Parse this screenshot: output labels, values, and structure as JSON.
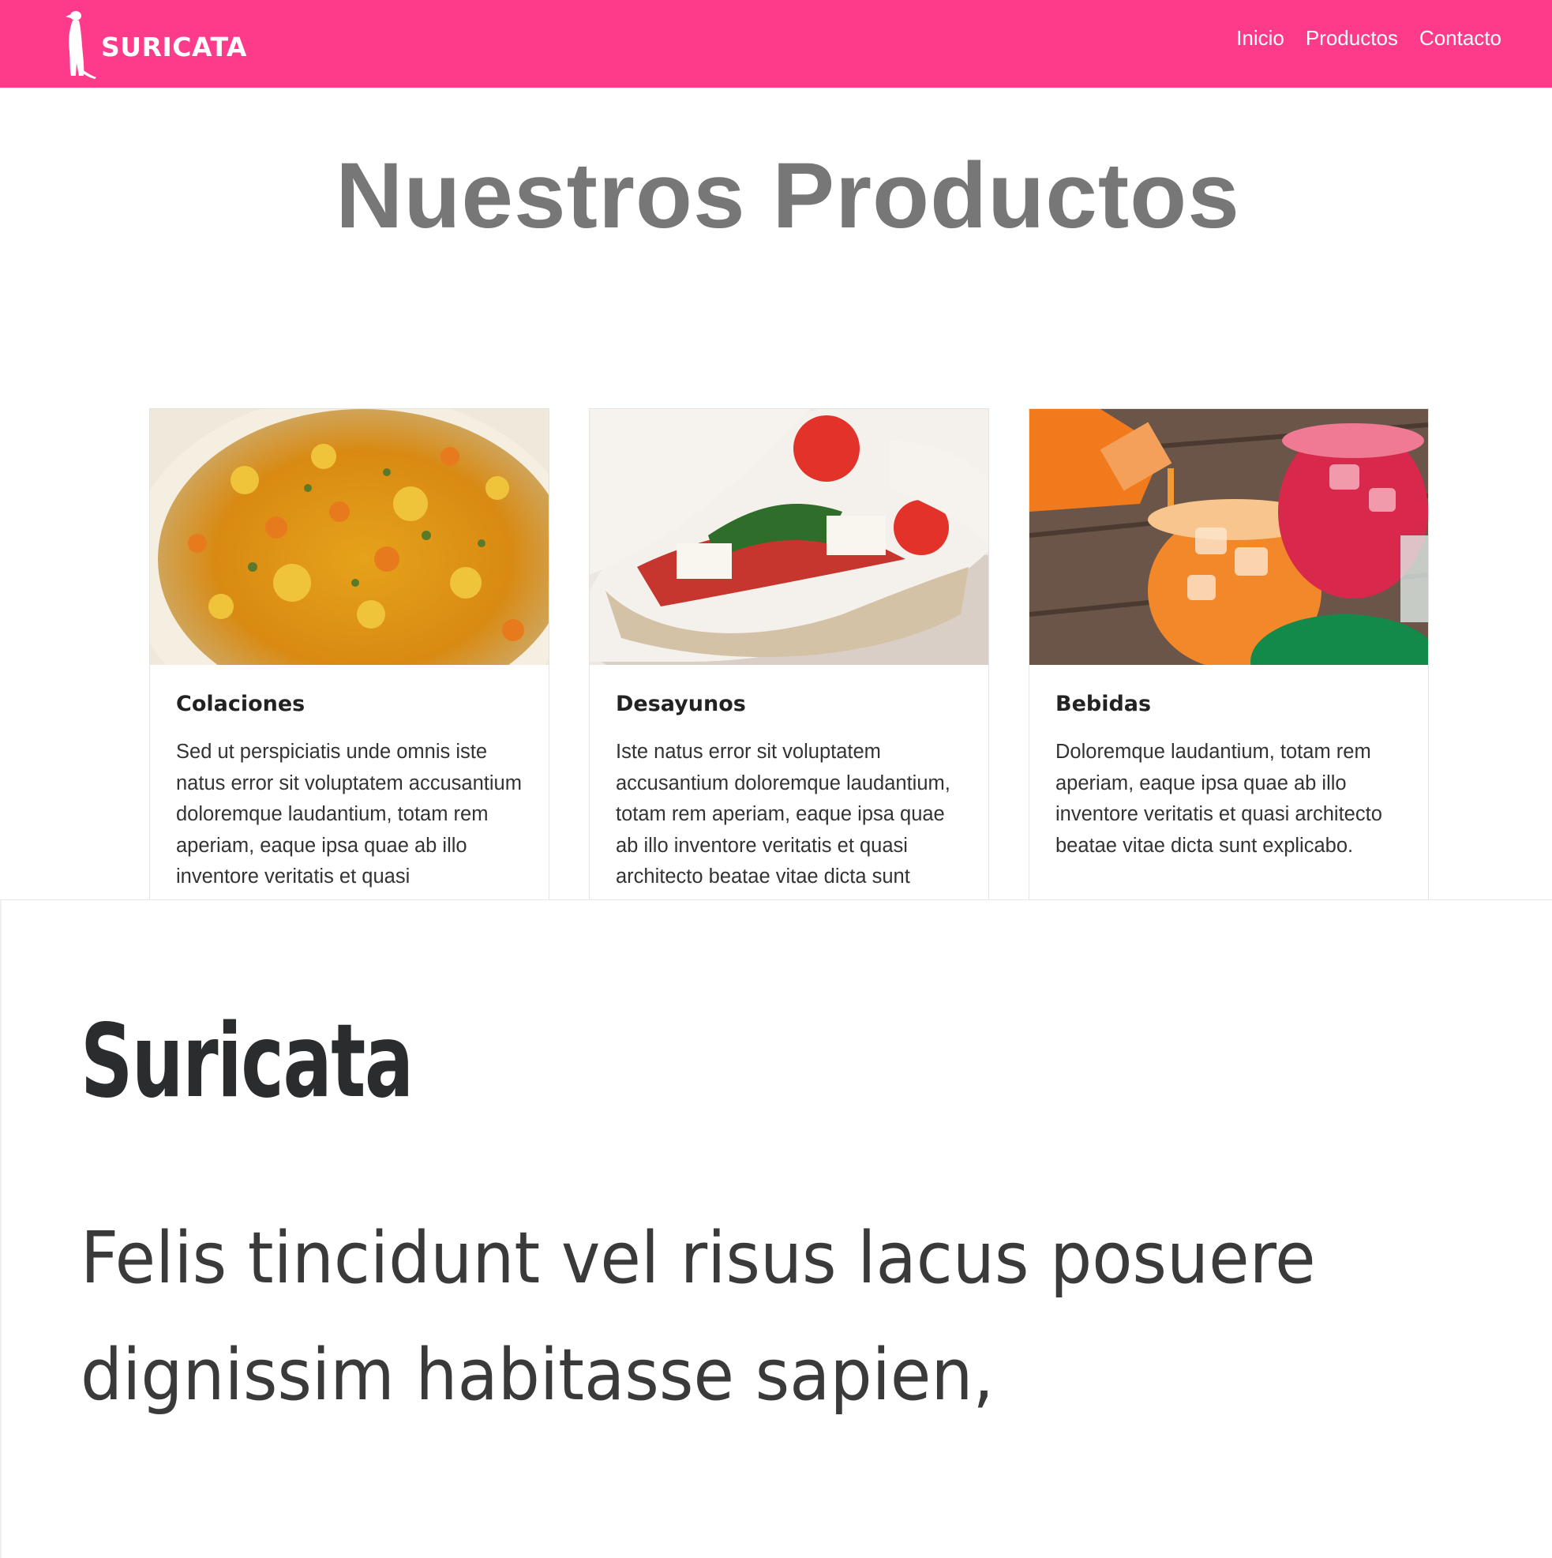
{
  "brand": {
    "name": "SURICATA",
    "logo_icon": "meerkat-icon"
  },
  "nav": {
    "items": [
      "Inicio",
      "Productos",
      "Contacto"
    ]
  },
  "page": {
    "title": "Nuestros Productos"
  },
  "products": [
    {
      "title": "Colaciones",
      "image": "food-bowl-image",
      "text": "Sed ut perspiciatis unde omnis iste natus error sit voluptatem accusantium doloremque laudantium, totam rem aperiam, eaque ipsa quae ab illo inventore veritatis et quasi"
    },
    {
      "title": "Desayunos",
      "image": "sandwich-image",
      "text": "Iste natus error sit voluptatem accusantium doloremque laudantium, totam rem aperiam, eaque ipsa quae ab illo inventore veritatis et quasi architecto beatae vitae dicta sunt"
    },
    {
      "title": "Bebidas",
      "image": "drinks-image",
      "text": "Doloremque laudantium, totam rem aperiam, eaque ipsa quae ab illo inventore veritatis et quasi architecto beatae vitae dicta sunt explicabo."
    }
  ],
  "lower_section": {
    "title": "Suricata",
    "text": "Felis tincidunt vel risus lacus posuere dignissim habitasse sapien,"
  },
  "colors": {
    "navbar": "#fe3a8a",
    "title": "#777777"
  }
}
